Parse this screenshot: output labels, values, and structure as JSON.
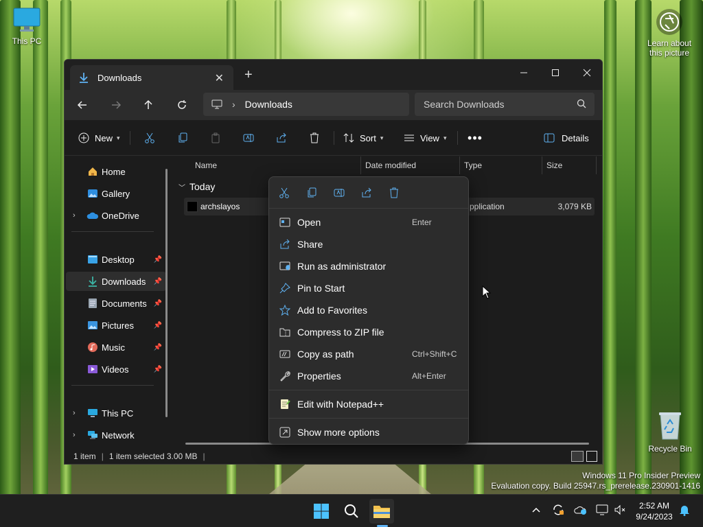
{
  "desktop": {
    "this_pc_label": "This PC",
    "learn_label_1": "Learn about",
    "learn_label_2": "this picture",
    "recycle_label": "Recycle Bin",
    "watermark_line1": "Windows 11 Pro Insider Preview",
    "watermark_line2": "Evaluation copy. Build 25947.rs_prerelease.230901-1416"
  },
  "window": {
    "tab_title": "Downloads",
    "address_crumb": "Downloads",
    "search_placeholder": "Search Downloads"
  },
  "commandbar": {
    "new_label": "New",
    "sort_label": "Sort",
    "view_label": "View",
    "details_label": "Details"
  },
  "sidebar": {
    "items": [
      {
        "label": "Home"
      },
      {
        "label": "Gallery"
      },
      {
        "label": "OneDrive"
      },
      {
        "label": "Desktop"
      },
      {
        "label": "Downloads"
      },
      {
        "label": "Documents"
      },
      {
        "label": "Pictures"
      },
      {
        "label": "Music"
      },
      {
        "label": "Videos"
      },
      {
        "label": "This PC"
      },
      {
        "label": "Network"
      }
    ]
  },
  "filelist": {
    "columns": [
      "Name",
      "Date modified",
      "Type",
      "Size"
    ],
    "group_label": "Today",
    "rows": [
      {
        "name": "archslayos",
        "type": "pplication",
        "size": "3,079 KB"
      }
    ]
  },
  "status": {
    "count": "1 item",
    "selection": "1 item selected  3.00 MB"
  },
  "context_menu": {
    "items": [
      {
        "label": "Open",
        "shortcut": "Enter"
      },
      {
        "label": "Share",
        "shortcut": ""
      },
      {
        "label": "Run as administrator",
        "shortcut": ""
      },
      {
        "label": "Pin to Start",
        "shortcut": ""
      },
      {
        "label": "Add to Favorites",
        "shortcut": ""
      },
      {
        "label": "Compress to ZIP file",
        "shortcut": ""
      },
      {
        "label": "Copy as path",
        "shortcut": "Ctrl+Shift+C"
      },
      {
        "label": "Properties",
        "shortcut": "Alt+Enter"
      },
      {
        "label": "Edit with Notepad++",
        "shortcut": ""
      },
      {
        "label": "Show more options",
        "shortcut": ""
      }
    ]
  },
  "taskbar": {
    "time": "2:52 AM",
    "date": "9/24/2023"
  },
  "colors": {
    "accent": "#5fb2f2",
    "folder_yellow": "#f2c14e",
    "window_bg": "#1c1c1c",
    "menu_bg": "#2c2c2c"
  }
}
